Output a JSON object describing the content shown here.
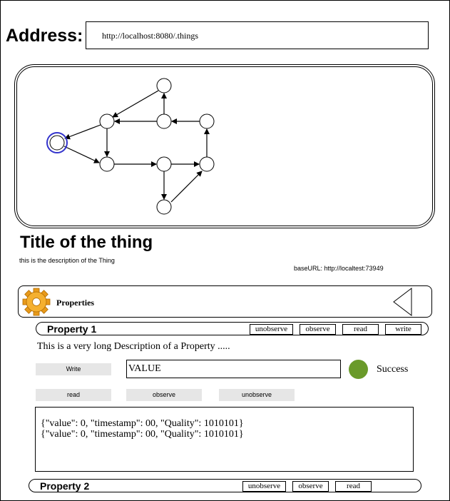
{
  "address": {
    "label": "Address:",
    "url": "http://localhost:8080/.things"
  },
  "thing": {
    "title": "Title of the thing",
    "description": "this is the description of the Thing",
    "base_url": "baseURL: http://localtest:73949"
  },
  "properties_section": {
    "label": "Properties",
    "icon": "gear-icon",
    "collapse_icon": "triangle-left-icon"
  },
  "property1": {
    "title": "Property 1",
    "actions": [
      "unobserve",
      "observe",
      "read",
      "write"
    ],
    "description": "This is a very long Description of a Property .....",
    "write_label": "Write",
    "value": "VALUE",
    "status": "Success",
    "status_color": "#6a9a2a",
    "buttons": [
      "read",
      "observe",
      "unobserve"
    ],
    "log": [
      "{\"value\": 0, \"timestamp\": 00, \"Quality\": 1010101}",
      "{\"value\": 0, \"timestamp\": 00, \"Quality\": 1010101}"
    ]
  },
  "property2": {
    "title": "Property 2",
    "actions": [
      "unobserve",
      "observe",
      "read"
    ]
  },
  "colors": {
    "selected_node": "#3333cc",
    "gear": "#f0a020"
  }
}
